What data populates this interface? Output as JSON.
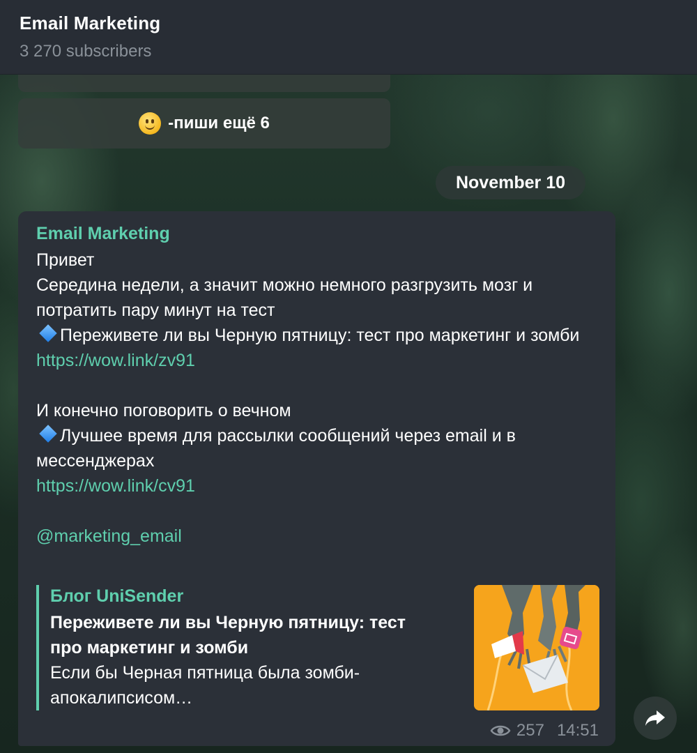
{
  "header": {
    "title": "Email Marketing",
    "subscribers": "3 270 subscribers"
  },
  "keyboard": {
    "main_button_label": "-пиши ещё 6",
    "main_button_icon": "slightly-smiling-face-emoji"
  },
  "date_separator": "November 10",
  "message": {
    "author": "Email Marketing",
    "greeting": "Привет",
    "intro": "Середина недели, а значит можно немного разгрузить мозг и потратить пару минут на тест",
    "item1_text": "Переживете ли вы Черную пятницу: тест про маркетинг и зомби",
    "item1_link": "https://wow.link/zv91",
    "para2": "И конечно поговорить о вечном",
    "item2_text": "Лучшее время для рассылки сообщений через email и в мессенджерах",
    "item2_link": "https://wow.link/cv91",
    "mention": "@marketing_email",
    "bullet_icon": "small-blue-diamond-emoji",
    "views": "257",
    "time": "14:51"
  },
  "link_preview": {
    "site": "Блог UniSender",
    "title": "Переживете ли вы Черную пятницу: тест про маркетинг и зомби",
    "description": "Если бы Черная пятница была зомби-апокалипсисом…"
  },
  "icons": {
    "views": "eye-icon",
    "forward": "share-arrow-icon"
  },
  "colors": {
    "accent": "#5fcfae",
    "bubble": "#2b3038",
    "header": "#282d35",
    "meta_text": "#8a9199",
    "thumbnail_bg": "#f6a41c"
  }
}
